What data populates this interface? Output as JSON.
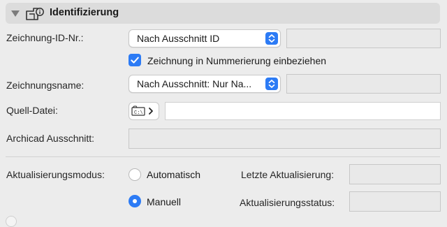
{
  "section": {
    "title": "Identifizierung"
  },
  "drawing_id": {
    "label": "Zeichnung-ID-Nr.:",
    "selected": "Nach Ausschnitt ID",
    "value": ""
  },
  "include_in_numbering": {
    "label": "Zeichnung in Nummerierung einbeziehen",
    "checked": true
  },
  "drawing_name": {
    "label": "Zeichnungsname:",
    "selected": "Nach Ausschnitt: Nur Na...",
    "value": ""
  },
  "source_file": {
    "label": "Quell-Datei:",
    "path": ""
  },
  "archicad_view": {
    "label": "Archicad Ausschnitt:",
    "value": ""
  },
  "update_mode": {
    "label": "Aktualisierungsmodus:",
    "options": [
      "Automatisch",
      "Manuell"
    ],
    "selected": "Manuell"
  },
  "last_update": {
    "label": "Letzte Aktualisierung:",
    "value": ""
  },
  "update_status": {
    "label": "Aktualisierungsstatus:",
    "value": ""
  },
  "colors": {
    "accent": "#2c7bf5",
    "panel": "#ececec",
    "header": "#dcdcdc"
  }
}
